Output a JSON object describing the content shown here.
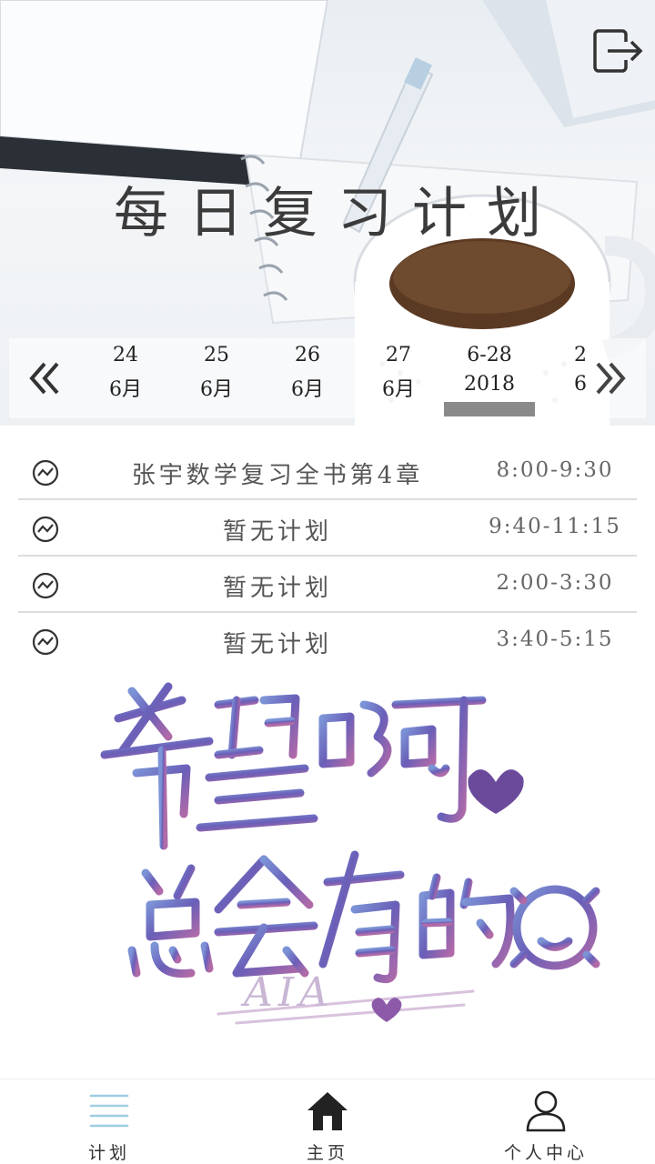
{
  "header": {
    "title": "每日复习计划",
    "logout_icon": "logout-icon"
  },
  "date_strip": {
    "prev_icon": "double-chevron-left-icon",
    "next_icon": "double-chevron-right-icon",
    "dates": [
      {
        "line1": "24",
        "line2": "6月"
      },
      {
        "line1": "25",
        "line2": "6月"
      },
      {
        "line1": "26",
        "line2": "6月"
      },
      {
        "line1": "27",
        "line2": "6月"
      },
      {
        "line1": "6-28",
        "line2": "2018"
      },
      {
        "line1": "2",
        "line2": "6"
      }
    ],
    "selected_index": 4
  },
  "plans": [
    {
      "title": "张宇数学复习全书第4章",
      "time": "8:00-9:30",
      "icon": "chart-circle-icon"
    },
    {
      "title": "暂无计划",
      "time": "9:40-11:15",
      "icon": "chart-circle-icon"
    },
    {
      "title": "暂无计划",
      "time": "2:00-3:30",
      "icon": "chart-circle-icon"
    },
    {
      "title": "暂无计划",
      "time": "3:40-5:15",
      "icon": "chart-circle-icon"
    }
  ],
  "art": {
    "text_line1": "希望啊",
    "text_line2": "总会有的",
    "signature": "AIA"
  },
  "bottom_nav": {
    "items": [
      {
        "label": "计划",
        "icon": "list-icon"
      },
      {
        "label": "主页",
        "icon": "home-icon"
      },
      {
        "label": "个人中心",
        "icon": "user-icon"
      }
    ],
    "active_index": 0
  },
  "colors": {
    "active_icon": "#9ecde3",
    "divider": "#dcdcdc",
    "selected_bar": "#8a8a8a"
  }
}
